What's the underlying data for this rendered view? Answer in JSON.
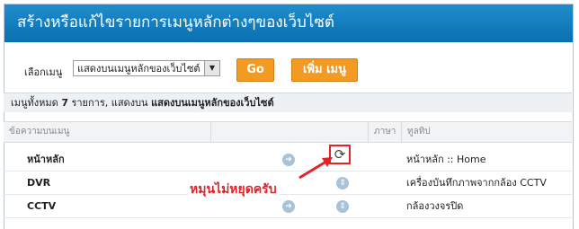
{
  "header": {
    "title": "สร้างหรือแก้ไขรายการเมนูหลักต่างๆของเว็บไซต์"
  },
  "toolbar": {
    "menu_label": "เลือกเมนู",
    "menu_value": "แสดงบนเมนูหลักของเว็บไซต์",
    "go_label": "Go",
    "add_label": "เพิ่ม เมนู"
  },
  "summary": {
    "prefix": "เมนูทั้งหมด",
    "count": "7",
    "suffix": "รายการ, แสดงบน",
    "location": "แสดงบนเมนูหลักของเว็บไซต์"
  },
  "table": {
    "headers": {
      "text": "ข้อความบนเมนู",
      "lang": "ภาษา",
      "tooltip": "ทูลทิป"
    },
    "rows": [
      {
        "name": "หน้าหลัก",
        "tooltip": "หน้าหลัก :: Home"
      },
      {
        "name": "DVR",
        "tooltip": "เครื่องบันทึกภาพจากกล้อง CCTV"
      },
      {
        "name": "CCTV",
        "tooltip": "กล้องวงจรปิด"
      }
    ]
  },
  "annotation": {
    "text": "หมุนไม่หยุดครับ",
    "color": "#e0242a"
  },
  "colors": {
    "header": "#0a6fb0",
    "button": "#f39a22",
    "icon": "#a8c3d8"
  }
}
